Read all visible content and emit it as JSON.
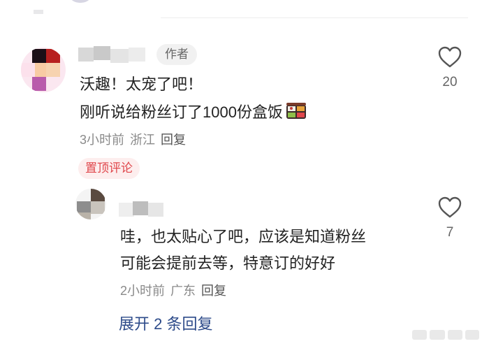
{
  "comment1": {
    "author_tag": "作者",
    "text_line1": "沃趣！太宠了吧！",
    "text_line2": "刚听说给粉丝订了1000份盒饭",
    "emoji_icon": "bento-box-icon",
    "time": "3小时前",
    "location": "浙江",
    "reply_label": "回复",
    "likes": "20",
    "pinned_label": "置顶评论"
  },
  "comment2": {
    "text_line1": "哇，也太贴心了吧，应该是知道粉丝",
    "text_line2": "可能会提前去等，特意订的好好",
    "time": "2小时前",
    "location": "广东",
    "reply_label": "回复",
    "likes": "7"
  },
  "expand_replies_label": "展开 2 条回复",
  "colors": {
    "pinned_red": "#e0474c",
    "link_blue": "#2d4b8a",
    "meta_gray": "#8a8a8a"
  }
}
